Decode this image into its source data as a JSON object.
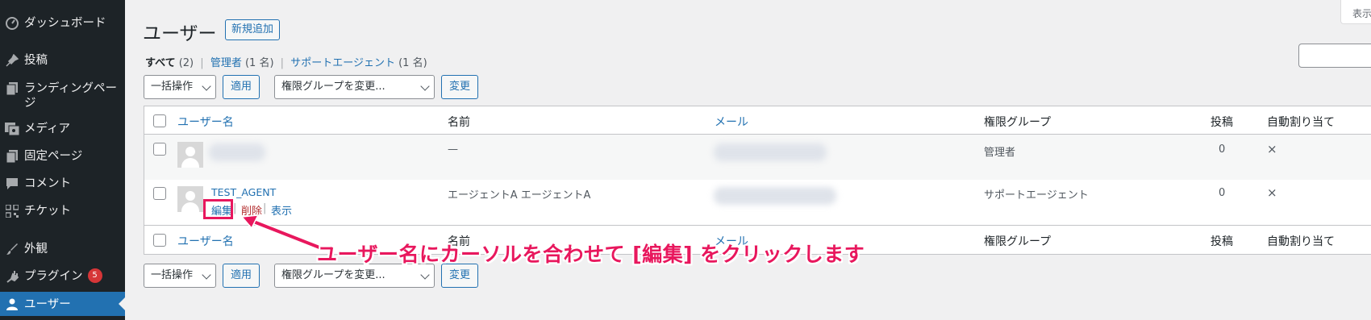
{
  "sidebar": {
    "items": [
      {
        "label": "ダッシュボード",
        "icon": "dashboard-icon"
      },
      {
        "label": "投稿",
        "icon": "pin-icon"
      },
      {
        "label": "ランディングページ",
        "icon": "pages-icon"
      },
      {
        "label": "メディア",
        "icon": "media-icon"
      },
      {
        "label": "固定ページ",
        "icon": "page-icon"
      },
      {
        "label": "コメント",
        "icon": "comment-icon"
      },
      {
        "label": "チケット",
        "icon": "ticket-icon"
      },
      {
        "label": "外観",
        "icon": "appearance-icon"
      },
      {
        "label": "プラグイン",
        "icon": "plugin-icon",
        "badge": "5"
      },
      {
        "label": "ユーザー",
        "icon": "user-icon",
        "current": true
      }
    ]
  },
  "top": {
    "screen_options": "表示"
  },
  "header": {
    "title": "ユーザー",
    "add_new": "新規追加"
  },
  "filters": {
    "all": "すべて",
    "all_count": "(2)",
    "admin": "管理者",
    "admin_count": "(1 名)",
    "support": "サポートエージェント",
    "support_count": "(1 名)"
  },
  "bulk": {
    "action": "一括操作",
    "apply": "適用",
    "role_change": "権限グループを変更...",
    "change": "変更"
  },
  "table": {
    "columns": {
      "username": "ユーザー名",
      "name": "名前",
      "email": "メール",
      "role": "権限グループ",
      "posts": "投稿",
      "auto": "自動割り当て"
    },
    "rows": [
      {
        "username": "",
        "name": "—",
        "role": "管理者",
        "posts": "0",
        "auto": "×"
      },
      {
        "username": "TEST_AGENT",
        "name": "エージェントA エージェントA",
        "role": "サポートエージェント",
        "posts": "0",
        "auto": "×",
        "actions": {
          "edit": "編集",
          "delete": "削除",
          "view": "表示"
        }
      }
    ]
  },
  "annotation": "ユーザー名にカーソルを合わせて [編集] をクリックします",
  "colors": {
    "accent": "#2271b1",
    "sidebar": "#1d2327",
    "highlight": "#e8175d",
    "badge": "#d63638"
  }
}
